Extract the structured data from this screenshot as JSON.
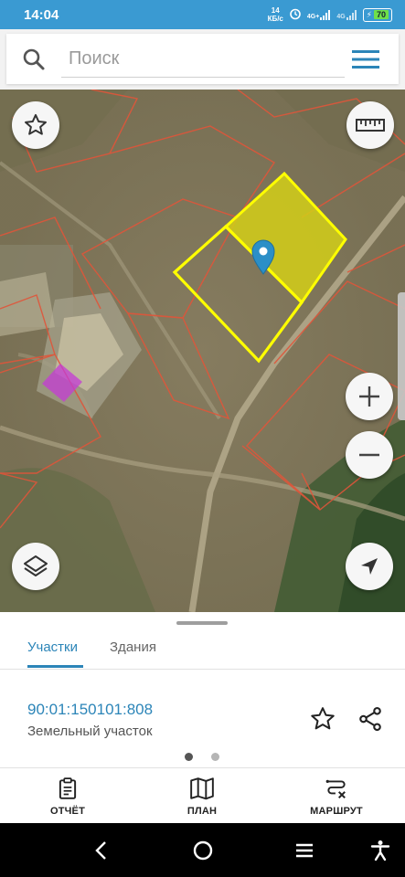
{
  "status_bar": {
    "time": "14:04",
    "speed_value": "14",
    "speed_unit": "КБ/с",
    "battery": "70",
    "network_1": "4G+",
    "network_2": "4G"
  },
  "search": {
    "placeholder": "Поиск"
  },
  "map": {
    "zoom_in_icon": "plus-icon",
    "zoom_out_icon": "minus-icon",
    "colors": {
      "selected_fill": "#d7d21a",
      "selected_outline": "#ffff00",
      "parcel_border": "#e0553a",
      "marker": "#2b8fc7",
      "other_parcel": "#c43bd6"
    }
  },
  "sheet": {
    "tabs": [
      {
        "label": "Участки",
        "active": true
      },
      {
        "label": "Здания",
        "active": false
      }
    ],
    "parcel": {
      "id": "90:01:150101:808",
      "type": "Земельный участок"
    },
    "page": 1,
    "pages": 2
  },
  "bottom_nav": {
    "report": "ОТЧЁТ",
    "plan": "ПЛАН",
    "route": "МАРШРУТ"
  },
  "theme": {
    "accent": "#2c85b8",
    "status_bar": "#3a9ad2"
  }
}
